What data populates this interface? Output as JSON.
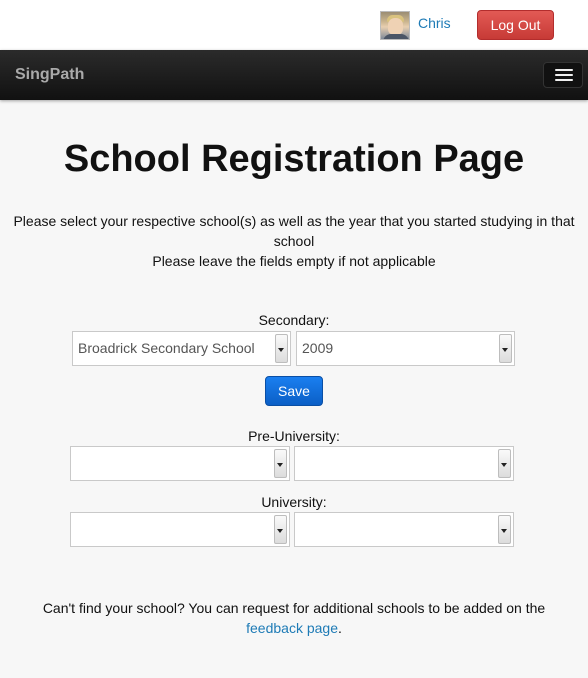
{
  "user": {
    "name": "Chris",
    "logout_label": "Log Out"
  },
  "navbar": {
    "brand": "SingPath"
  },
  "page": {
    "title": "School Registration Page",
    "instruction_line1": "Please select your respective school(s) as well as the year that you started studying in that school",
    "instruction_line2": "Please leave the fields empty if not applicable"
  },
  "secondary": {
    "label": "Secondary:",
    "school": "Broadrick Secondary School",
    "year": "2009"
  },
  "save_label": "Save",
  "pre_university": {
    "label": "Pre-University:",
    "school": "",
    "year": ""
  },
  "university": {
    "label": "University:",
    "school": "",
    "year": ""
  },
  "footer": {
    "text_before": "Can't find your school? You can request for additional schools to be added on the",
    "link_text": "feedback page",
    "text_after": "."
  },
  "colors": {
    "link": "#1e7bb6",
    "logout": "#d9534f",
    "save": "#0b6fd6",
    "navbar": "#1b1b1b"
  }
}
